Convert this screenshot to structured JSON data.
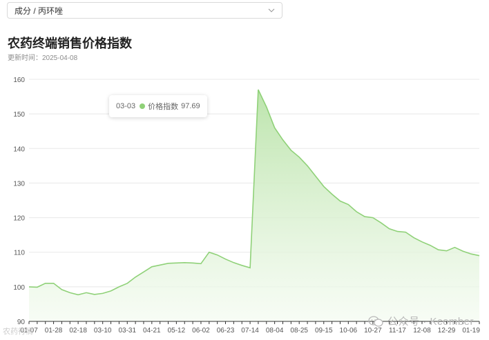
{
  "filter": {
    "selected": "成分 / 丙环唑"
  },
  "header": {
    "title": "农药终端销售价格指数",
    "updated_label": "更新时间：",
    "updated_date": "2025-04-08"
  },
  "tooltip": {
    "date": "03-03",
    "series": "价格指数",
    "value": "97.69"
  },
  "watermark": {
    "text": "公众号 · Kcomber",
    "small_text": "农药行情"
  },
  "colors": {
    "line": "#8fd178",
    "area_top": "#b9e3a8",
    "area_bottom": "#f4fbf1",
    "grid": "#e8e8e8",
    "axis_text": "#555555"
  },
  "chart_data": {
    "type": "area",
    "title": "农药终端销售价格指数",
    "ylim": [
      90,
      160
    ],
    "yticks": [
      90,
      100,
      110,
      120,
      130,
      140,
      150,
      160
    ],
    "x_labels": [
      "01-07",
      "01-28",
      "02-18",
      "03-10",
      "03-31",
      "04-21",
      "05-12",
      "06-02",
      "06-23",
      "07-14",
      "08-04",
      "08-25",
      "09-15",
      "10-06",
      "10-27",
      "11-17",
      "12-08",
      "12-29",
      "01-19"
    ],
    "x_label_weeks": [
      0,
      3,
      6,
      9,
      12,
      15,
      18,
      21,
      24,
      27,
      30,
      33,
      36,
      39,
      42,
      45,
      48,
      51,
      54
    ],
    "grid": true,
    "values": [
      100.0,
      99.9,
      101.0,
      101.0,
      99.2,
      98.3,
      97.7,
      98.3,
      97.8,
      98.1,
      98.8,
      100.0,
      101.0,
      102.8,
      104.3,
      105.8,
      106.3,
      106.8,
      106.9,
      107.0,
      106.9,
      106.7,
      110.0,
      109.2,
      108.0,
      107.0,
      106.2,
      105.5,
      157.0,
      152.0,
      146.0,
      142.5,
      139.5,
      137.5,
      135.0,
      132.0,
      129.0,
      126.8,
      124.8,
      123.8,
      121.7,
      120.3,
      120.0,
      118.5,
      116.8,
      116.0,
      115.8,
      114.2,
      113.0,
      112.0,
      110.7,
      110.4,
      111.4,
      110.3,
      109.5,
      109.0
    ]
  }
}
